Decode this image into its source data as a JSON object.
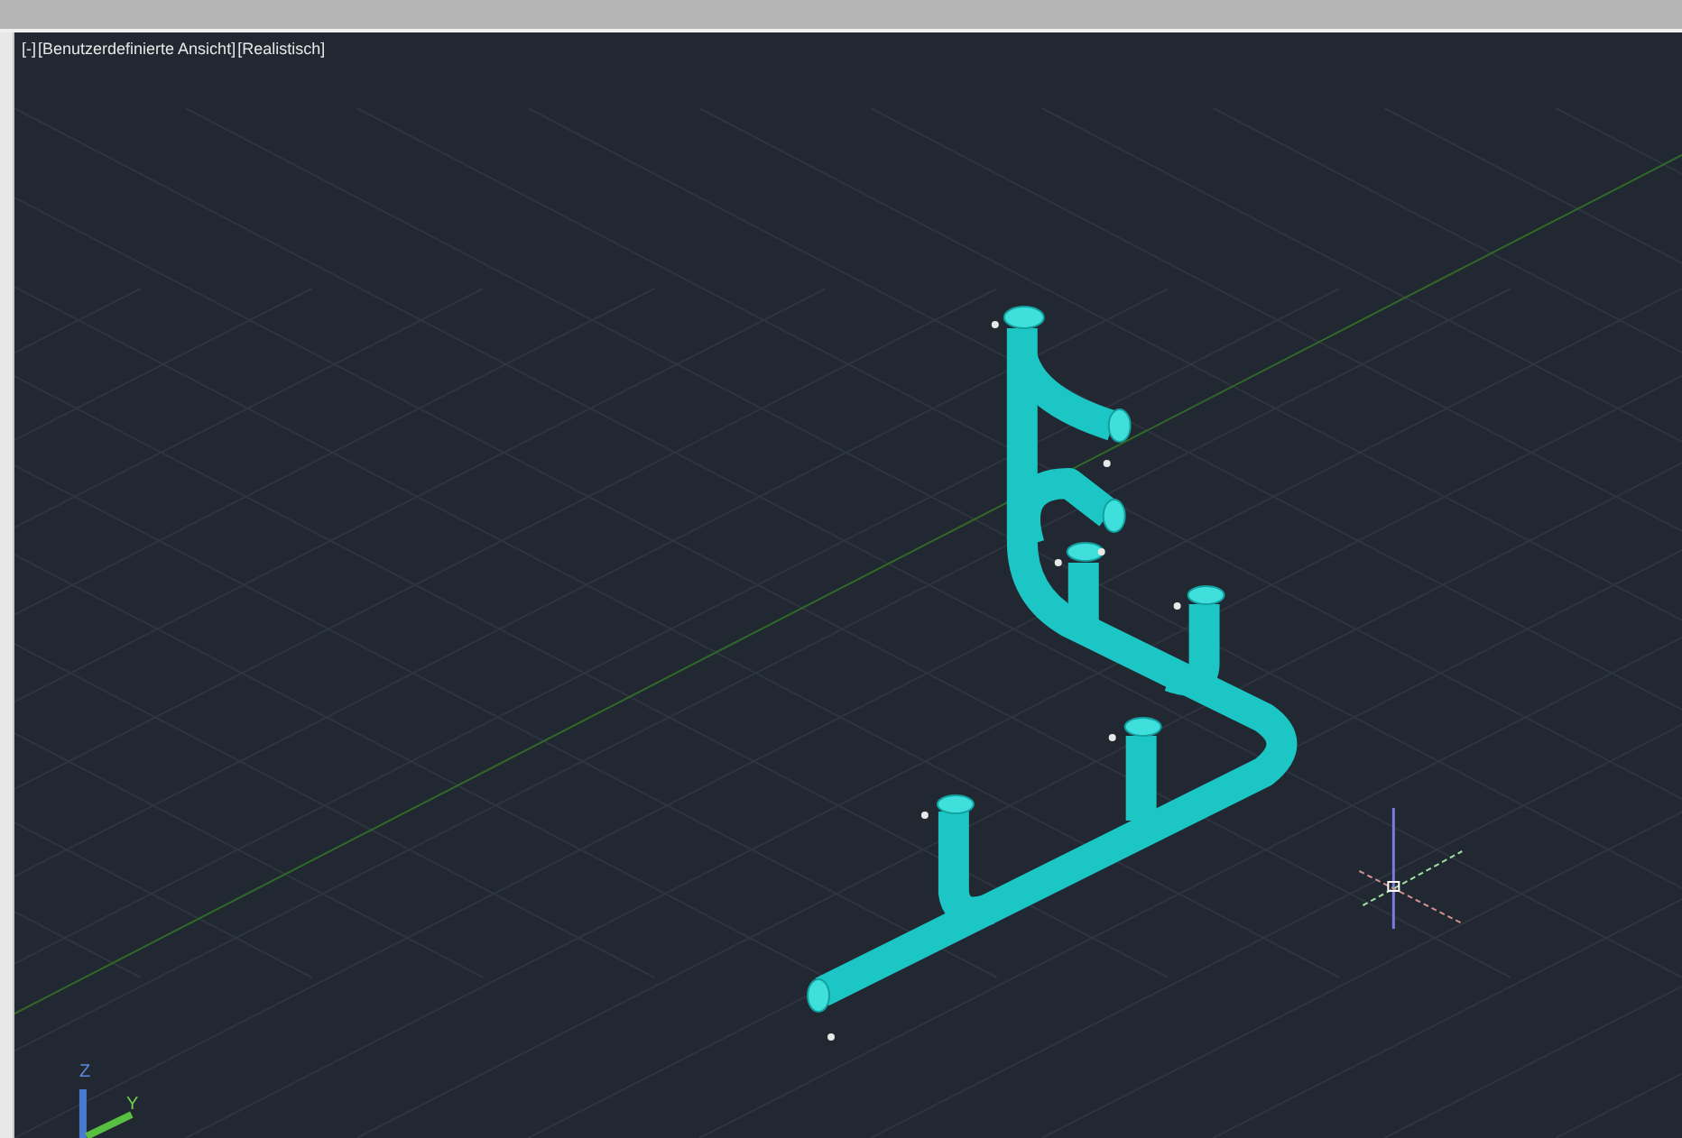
{
  "viewport": {
    "controls": [
      {
        "label": "[-]"
      },
      {
        "label": "[Benutzerdefinierte Ansicht]"
      },
      {
        "label": "[Realistisch]"
      }
    ],
    "ucs_axes": [
      {
        "label": "Z"
      },
      {
        "label": "Y"
      }
    ]
  }
}
